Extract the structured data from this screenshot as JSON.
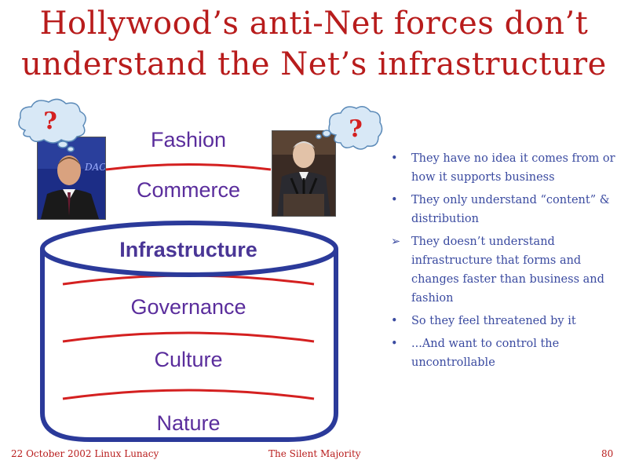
{
  "slide": {
    "title_line1": "Hollywood’s anti-Net forces don’t",
    "title_line2": "understand the Net’s infrastructure"
  },
  "layers": [
    {
      "label": "Fashion",
      "emphasis": false
    },
    {
      "label": "Commerce",
      "emphasis": false
    },
    {
      "label": "Infrastructure",
      "emphasis": true
    },
    {
      "label": "Governance",
      "emphasis": false
    },
    {
      "label": "Culture",
      "emphasis": false
    },
    {
      "label": "Nature",
      "emphasis": false
    }
  ],
  "thought_clouds": {
    "left_symbol": "?",
    "right_symbol": "?"
  },
  "bullets": [
    {
      "marker": "•",
      "text": "They have no idea it comes from or how it supports business"
    },
    {
      "marker": "•",
      "text": "They only understand “content” & distribution"
    },
    {
      "marker": "➢",
      "text": "They doesn’t understand infrastructure that forms and changes faster than business and fashion"
    },
    {
      "marker": "•",
      "text": "So they feel threatened by it"
    },
    {
      "marker": "•",
      "text": "...And want to control the uncontrollable"
    }
  ],
  "footer": {
    "left": "22 October 2002 Linux Lunacy",
    "center": "The Silent Majority",
    "page_number": "80"
  },
  "colors": {
    "title": "#b81c1c",
    "layer_text": "#5a2d9c",
    "cylinder": "#2b3a9a",
    "divider": "#d42020",
    "bullet_text": "#3a4aa0"
  }
}
